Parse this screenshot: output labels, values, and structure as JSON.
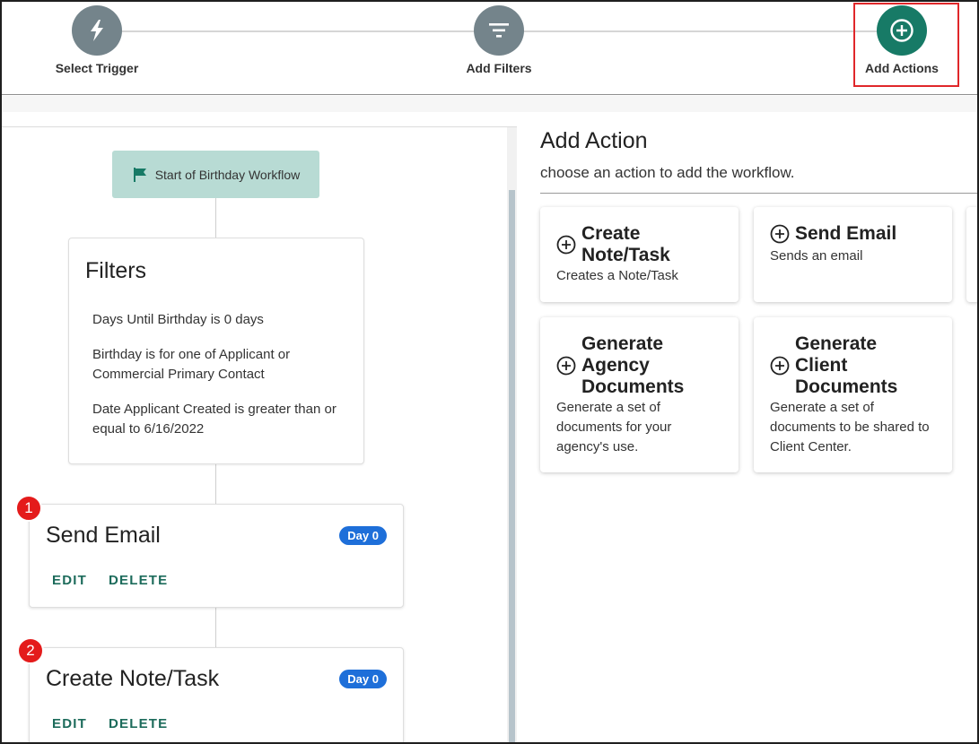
{
  "stepper": {
    "steps": [
      {
        "label": "Select Trigger",
        "icon": "lightning-bolt-icon"
      },
      {
        "label": "Add Filters",
        "icon": "filter-icon"
      },
      {
        "label": "Add Actions",
        "icon": "plus-circle-icon"
      }
    ],
    "active_color": "#177a66",
    "done_color": "#74848b"
  },
  "workflow": {
    "start_label": "Start of Birthday Workflow",
    "filters": {
      "title": "Filters",
      "items": [
        "Days Until Birthday is 0 days",
        "Birthday is for one of Applicant or Commercial Primary Contact",
        "Date Applicant Created is greater than or equal to 6/16/2022"
      ]
    },
    "actions": [
      {
        "number": "1",
        "title": "Send Email",
        "badge": "Day 0",
        "edit": "EDIT",
        "delete": "DELETE"
      },
      {
        "number": "2",
        "title": "Create Note/Task",
        "badge": "Day 0",
        "edit": "EDIT",
        "delete": "DELETE"
      }
    ]
  },
  "add_action": {
    "title": "Add Action",
    "subtitle": "choose an action to add the workflow.",
    "options": [
      {
        "title": "Create Note/Task",
        "description": "Creates a Note/Task"
      },
      {
        "title": "Send Email",
        "description": "Sends an email"
      },
      {
        "title": "Generate Agency Documents",
        "description": "Generate a set of documents for your agency's use."
      },
      {
        "title": "Generate Client Documents",
        "description": "Generate a set of documents to be shared to Client Center."
      }
    ]
  },
  "colors": {
    "primary_green": "#177a66",
    "start_node_bg": "#b8dbd4",
    "badge_blue": "#1e6fd9",
    "annotation_red": "#e41b1b"
  }
}
